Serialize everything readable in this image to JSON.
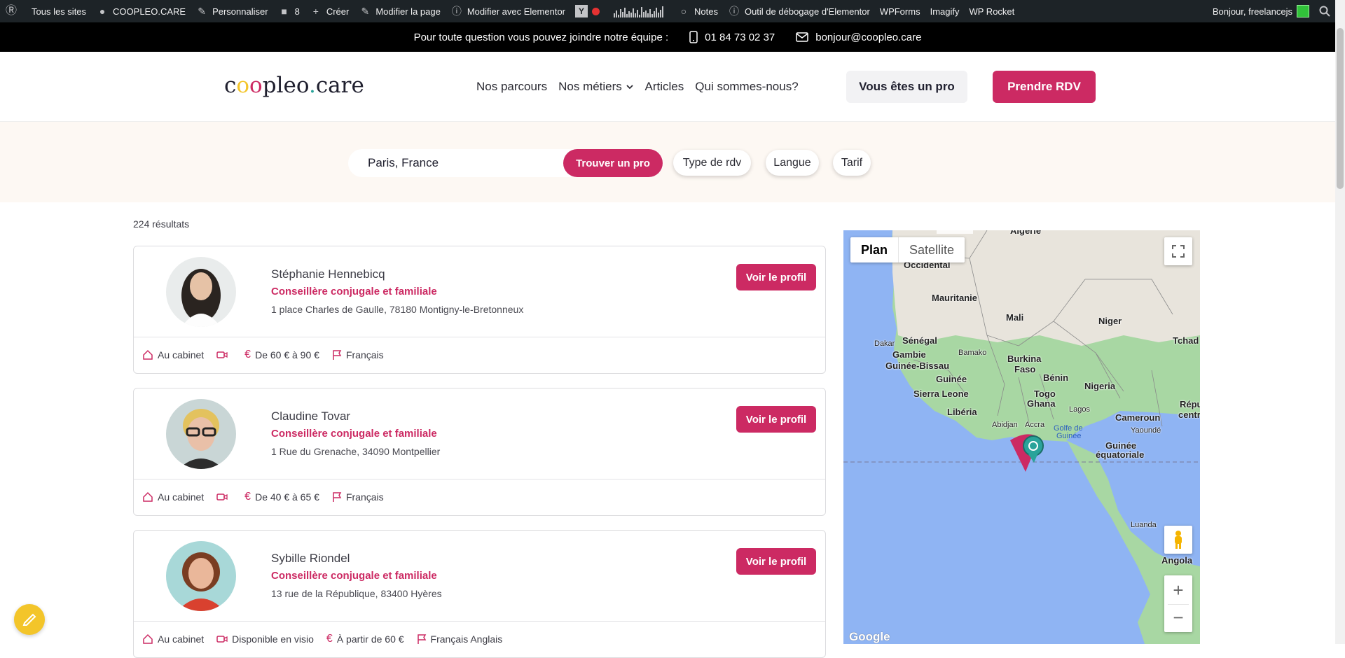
{
  "adminbar": {
    "items": [
      "Tous les sites",
      "COOPLEO.CARE",
      "Personnaliser",
      "8",
      "Créer",
      "Modifier la page",
      "Modifier avec Elementor",
      "Notes",
      "Outil de débogage d'Elementor",
      "WPForms",
      "Imagify",
      "WP Rocket"
    ],
    "greeting": "Bonjour, freelancejs"
  },
  "infobar": {
    "text": "Pour toute question vous pouvez joindre notre équipe :",
    "phone": "01 84 73 02 37",
    "email": "bonjour@coopleo.care"
  },
  "header": {
    "logo": {
      "c": "c",
      "o1": "o",
      "o2": "o",
      "rest": "pleo",
      "dot": ".",
      "care": "care"
    },
    "nav": [
      "Nos parcours",
      "Nos métiers",
      "Articles",
      "Qui sommes-nous?"
    ],
    "pro_button": "Vous êtes un pro",
    "rdv_button": "Prendre RDV"
  },
  "search": {
    "location_value": "Paris, France",
    "find_button": "Trouver un pro",
    "filters": [
      "Type de rdv",
      "Langue",
      "Tarif"
    ]
  },
  "results": {
    "count": "224 résultats",
    "cards": [
      {
        "name": "Stéphanie Hennebicq",
        "job": "Conseillère conjugale et familiale",
        "address": "1 place Charles de Gaulle, 78180 Montigny-le-Bretonneux",
        "button": "Voir le profil",
        "location": "Au cabinet",
        "visio": "",
        "price": "De 60 € à 90 €",
        "languages": "Français"
      },
      {
        "name": "Claudine Tovar",
        "job": "Conseillère conjugale et familiale",
        "address": "1 Rue du Grenache, 34090 Montpellier",
        "button": "Voir le profil",
        "location": "Au cabinet",
        "visio": "",
        "price": "De 40 € à 65 €",
        "languages": "Français"
      },
      {
        "name": "Sybille Riondel",
        "job": "Conseillère conjugale et familiale",
        "address": "13 rue de la République, 83400 Hyères",
        "button": "Voir le profil",
        "location": "Au cabinet",
        "visio": "Disponible en visio",
        "price": "À partir de 60 €",
        "languages": "Français Anglais"
      }
    ]
  },
  "map": {
    "type_plan": "Plan",
    "type_satellite": "Satellite",
    "labels": [
      "Algérie",
      "Occidental",
      "Mauritanie",
      "Mali",
      "Niger",
      "Tchad",
      "Sénégal",
      "Dakar",
      "Gambie",
      "Bamako",
      "Burkina",
      "Faso",
      "Guinée-Bissau",
      "Guinée",
      "Bénin",
      "Nigeria",
      "Sierra Leone",
      "Togo",
      "Ghana",
      "Libéria",
      "Lagos",
      "Abidjan",
      "Accra",
      "Golfe de",
      "Guinée",
      "Cameroun",
      "Répu",
      "centra",
      "Yaoundé",
      "Guinée",
      "équatoriale",
      "Luanda",
      "Angola"
    ],
    "google": "Google"
  },
  "colors": {
    "brand": "#cc2a63",
    "accent_yellow": "#f3c52a",
    "ocean": "#8fb4f3",
    "land": "#a8d7a3"
  }
}
